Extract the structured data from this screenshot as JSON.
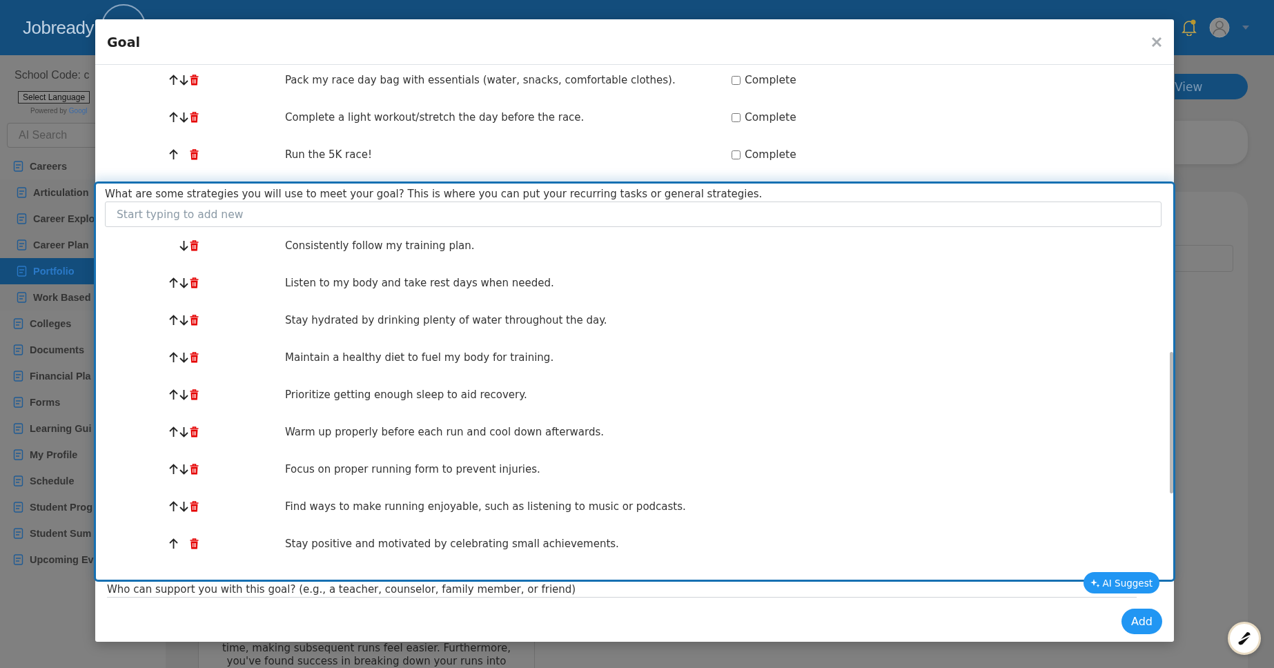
{
  "header": {
    "logo": "Jobready",
    "notification_dot": true
  },
  "sidebar": {
    "school_code": "School Code: c",
    "language_select": "Select Language",
    "powered_by": "Powered by",
    "powered_brand": "Googl",
    "search": {
      "placeholder": "AI Search"
    },
    "items": [
      {
        "label": "Careers",
        "selected": false,
        "children": [
          {
            "label": "Articulation",
            "selected": false
          },
          {
            "label": "Career Explo",
            "selected": false
          },
          {
            "label": "Career Plan",
            "selected": false
          },
          {
            "label": "Portfolio",
            "selected": true
          },
          {
            "label": "Work Based",
            "selected": false
          }
        ]
      },
      {
        "label": "Colleges",
        "selected": false
      },
      {
        "label": "Documents",
        "selected": false
      },
      {
        "label": "Financial Pla",
        "selected": false
      },
      {
        "label": "Forms",
        "selected": false
      },
      {
        "label": "Learning Gui",
        "selected": false
      },
      {
        "label": "My Profile",
        "selected": false
      },
      {
        "label": "Schedule",
        "selected": false
      },
      {
        "label": "Student Prog",
        "selected": false
      },
      {
        "label": "Student Sum",
        "selected": false
      },
      {
        "label": "Upcoming Ev",
        "selected": false
      }
    ]
  },
  "main": {
    "view_button": "View",
    "story_lines": [
      "time, making subsequent runs feel easier. Furthermore,",
      "you've found success in breaking down your runs into"
    ]
  },
  "modal": {
    "title": "Goal",
    "tasks": [
      {
        "text": "Pack my race day bag with essentials (water, snacks, comfortable clothes).",
        "move_up": true,
        "move_down": true,
        "complete_label": "Complete",
        "checked": false
      },
      {
        "text": "Complete a light workout/stretch the day before the race.",
        "move_up": true,
        "move_down": true,
        "complete_label": "Complete",
        "checked": false
      },
      {
        "text": "Run the 5K race!",
        "move_up": true,
        "move_down": false,
        "complete_label": "Complete",
        "checked": false
      }
    ],
    "strategies": {
      "question": "What are some strategies you will use to meet your goal? This is where you can put your recurring tasks or general strategies.",
      "input": {
        "placeholder": "Start typing to add new"
      },
      "items": [
        {
          "text": "Consistently follow my training plan.",
          "move_up": false,
          "move_down": true
        },
        {
          "text": "Listen to my body and take rest days when needed.",
          "move_up": true,
          "move_down": true
        },
        {
          "text": "Stay hydrated by drinking plenty of water throughout the day.",
          "move_up": true,
          "move_down": true
        },
        {
          "text": "Maintain a healthy diet to fuel my body for training.",
          "move_up": true,
          "move_down": true
        },
        {
          "text": "Prioritize getting enough sleep to aid recovery.",
          "move_up": true,
          "move_down": true
        },
        {
          "text": "Warm up properly before each run and cool down afterwards.",
          "move_up": true,
          "move_down": true
        },
        {
          "text": "Focus on proper running form to prevent injuries.",
          "move_up": true,
          "move_down": true
        },
        {
          "text": "Find ways to make running enjoyable, such as listening to music or podcasts.",
          "move_up": true,
          "move_down": true
        },
        {
          "text": "Stay positive and motivated by celebrating small achievements.",
          "move_up": true,
          "move_down": false
        }
      ],
      "ai_suggest": "AI Suggest"
    },
    "support_question": "Who can support you with this goal? (e.g., a teacher, counselor, family member, or friend)",
    "add_button": "Add"
  }
}
